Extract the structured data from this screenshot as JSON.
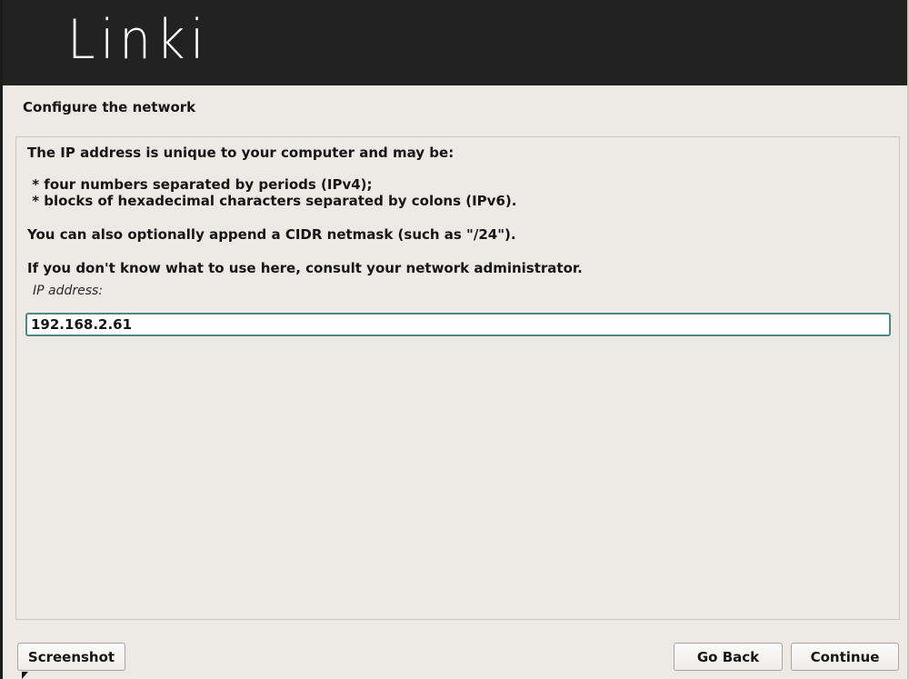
{
  "header": {
    "logo_text": "Linki"
  },
  "page": {
    "title": "Configure the network"
  },
  "panel": {
    "intro": "The IP address is unique to your computer and may be:",
    "bullets": [
      " * four numbers separated by periods (IPv4);",
      " * blocks of hexadecimal characters separated by colons (IPv6)."
    ],
    "cidr_note": "You can also optionally append a CIDR netmask (such as \"/24\").",
    "help": "If you don't know what to use here, consult your network administrator.",
    "field_label": "IP address:",
    "ip_value": "192.168.2.61"
  },
  "buttons": {
    "screenshot": "Screenshot",
    "go_back": "Go Back",
    "continue": "Continue"
  },
  "colors": {
    "header_bg": "#222222",
    "page_bg": "#edeae6",
    "input_border": "#4a8a88"
  }
}
